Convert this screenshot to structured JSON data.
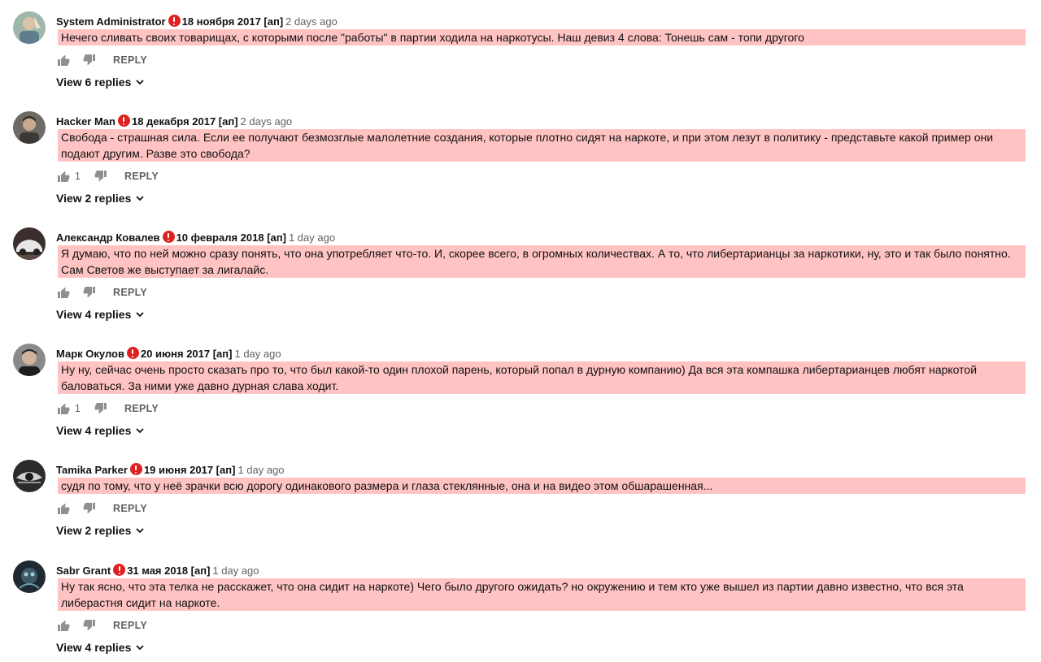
{
  "comments": [
    {
      "author": "System Administrator",
      "date": "18 ноября 2017 [ап]",
      "ago": "2 days ago",
      "text": "Нечего сливать своих товарищах, с которыми после \"работы\" в партии ходила на наркотусы. Наш девиз 4 слова: Тонешь сам - топи другого",
      "likes": "",
      "reply": "REPLY",
      "replies": "View 6 replies"
    },
    {
      "author": "Hacker Man",
      "date": "18 декабря 2017 [ап]",
      "ago": "2 days ago",
      "text": "Свобода - страшная сила. Если ее получают безмозглые малолетние создания, которые плотно сидят на наркоте, и при этом лезут в политику - представьте какой пример они подают другим. Разве это свобода?",
      "likes": "1",
      "reply": "REPLY",
      "replies": "View 2 replies"
    },
    {
      "author": "Александр Ковалев",
      "date": "10 февраля 2018 [ап]",
      "ago": "1 day ago",
      "text": "Я думаю, что по ней можно сразу понять, что она употребляет что-то. И, скорее всего, в огромных количествах. А то, что либертарианцы за наркотики, ну, это и так было понятно. Сам Светов же выступает за лигалайс.",
      "likes": "",
      "reply": "REPLY",
      "replies": "View 4 replies"
    },
    {
      "author": "Марк Окулов",
      "date": "20 июня 2017 [ап]",
      "ago": "1 day ago",
      "text": "Ну ну, сейчас очень просто сказать про то, что был какой-то один плохой парень, который попал в дурную компанию)  Да вся эта компашка либертарианцев любят наркотой баловаться. За ними уже давно дурная слава ходит.",
      "likes": "1",
      "reply": "REPLY",
      "replies": "View 4 replies"
    },
    {
      "author": "Tamika Parker",
      "date": "19 июня 2017 [ап]",
      "ago": "1 day ago",
      "text": "судя по тому, что у неё зрачки всю дорогу одинакового размера и глаза стеклянные, она и на видео этом обшарашенная...",
      "likes": "",
      "reply": "REPLY",
      "replies": "View 2 replies"
    },
    {
      "author": "Sabr Grant",
      "date": "31 мая 2018 [ап]",
      "ago": "1 day ago",
      "text": "Ну так ясно, что эта телка не расскажет, что она сидит на наркоте) Чего было другого ожидать? но окружению и тем кто уже вышел из партии давно известно, что вся эта либерастня сидит на наркоте.",
      "likes": "",
      "reply": "REPLY",
      "replies": "View 4 replies"
    }
  ]
}
